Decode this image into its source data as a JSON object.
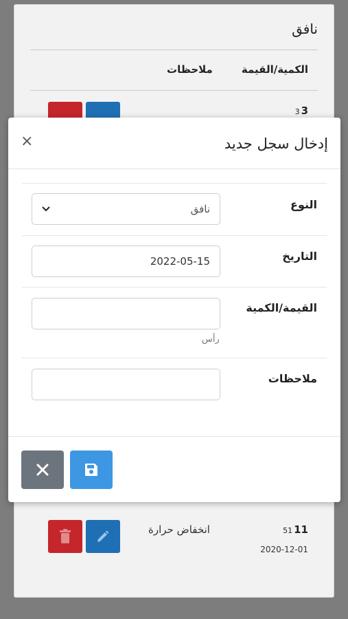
{
  "background": {
    "card_title": "نافق",
    "columns": {
      "value_qty": "الكمية/القيمة",
      "notes": "ملاحظات"
    },
    "rows": [
      {
        "id_main": "3",
        "id_sub": "3",
        "notes": "",
        "date": ""
      },
      {
        "id_main": "11",
        "id_sub": "51",
        "notes": "انخفاض حرارة",
        "date": "2020-12-01"
      }
    ]
  },
  "modal": {
    "title": "إدخال سجل جديد",
    "close_glyph": "×",
    "fields": {
      "type": {
        "label": "النوع",
        "value": "نافق"
      },
      "date": {
        "label": "التاريخ",
        "value": "2022-05-15"
      },
      "quantity": {
        "label": "القيمة/الكمية",
        "value": "",
        "help": "رأس"
      },
      "notes": {
        "label": "ملاحظات",
        "value": ""
      }
    },
    "buttons": {
      "cancel_icon": "close-icon",
      "save_icon": "floppy-disk-icon"
    }
  },
  "colors": {
    "danger": "#c4262b",
    "primary_dark": "#1f6fb4",
    "secondary": "#6c757d",
    "primary": "#3e97e2"
  }
}
